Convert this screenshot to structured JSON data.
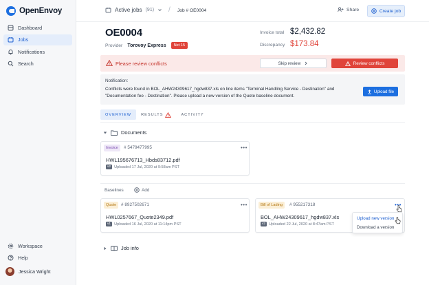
{
  "app": {
    "name": "OpenEnvoy"
  },
  "sidebar": {
    "items": [
      {
        "label": "Dashboard",
        "icon": "dashboard-icon"
      },
      {
        "label": "Jobs",
        "icon": "jobs-icon",
        "active": true
      },
      {
        "label": "Notifications",
        "icon": "bell-icon"
      },
      {
        "label": "Search",
        "icon": "search-icon"
      }
    ],
    "bottom_items": [
      {
        "label": "Workspace",
        "icon": "gear-icon"
      },
      {
        "label": "Help",
        "icon": "help-icon"
      }
    ],
    "user": {
      "name": "Jessica Wright"
    }
  },
  "topbar": {
    "section": "Active jobs",
    "count": "(91)",
    "breadcrumb": "Job # OE0004",
    "share": "Share",
    "create": "Create job"
  },
  "job": {
    "id": "OE0004",
    "provider_label": "Provider",
    "provider": "Torovoy Express",
    "terms": "Net 15",
    "invoice_total_label": "Invoice total",
    "invoice_total": "$2,432.82",
    "discrepancy_label": "Discrepancy",
    "discrepancy": "$173.84"
  },
  "banner": {
    "text": "Please review conflicts",
    "skip": "Skip review",
    "review": "Review conflicts"
  },
  "notification": {
    "heading": "Notification:",
    "line1": "Conflicts were found in BOL_AHW24309617_hgdw837.xls on line items \"Terminal Handling Service - Destination\" and",
    "line2": "\"Documentation fee - Destination\". Please upload a new version of the Quote baseline document.",
    "upload": "Upload file"
  },
  "tabs": [
    {
      "label": "OVERVIEW",
      "active": true
    },
    {
      "label": "RESULTS",
      "warning": true
    },
    {
      "label": "ACTIVITY"
    }
  ],
  "documents": {
    "title": "Documents",
    "items": [
      {
        "tag": "Invoice",
        "number": "# 5479477995",
        "file": "HWL195676713_Hbds83712.pdf",
        "version": "v2",
        "uploaded": "Uploaded 17 Jul, 2020 at 9:58am PST"
      }
    ]
  },
  "baselines": {
    "label": "Baselines",
    "add": "Add",
    "items": [
      {
        "tag": "Quote",
        "number": "# 8927502671",
        "file": "HWL0257667_Quote2349.pdf",
        "version": "v1",
        "uploaded": "Uploaded 16 Jul, 2020 at 11:14pm PST"
      },
      {
        "tag": "Bill of Lading",
        "number": "# 955217318",
        "file": "BOL_AHW24309617_hgdw837.xls",
        "version": "v2",
        "uploaded": "Uploaded 22 Jul, 2020 at 8:47am PST"
      }
    ]
  },
  "menu": {
    "items": [
      "Upload new version",
      "Download a version"
    ]
  },
  "job_info": {
    "title": "Job info"
  },
  "colors": {
    "accent": "#1d6fe0",
    "danger": "#e0443a",
    "active_bg": "#e4edfb"
  }
}
